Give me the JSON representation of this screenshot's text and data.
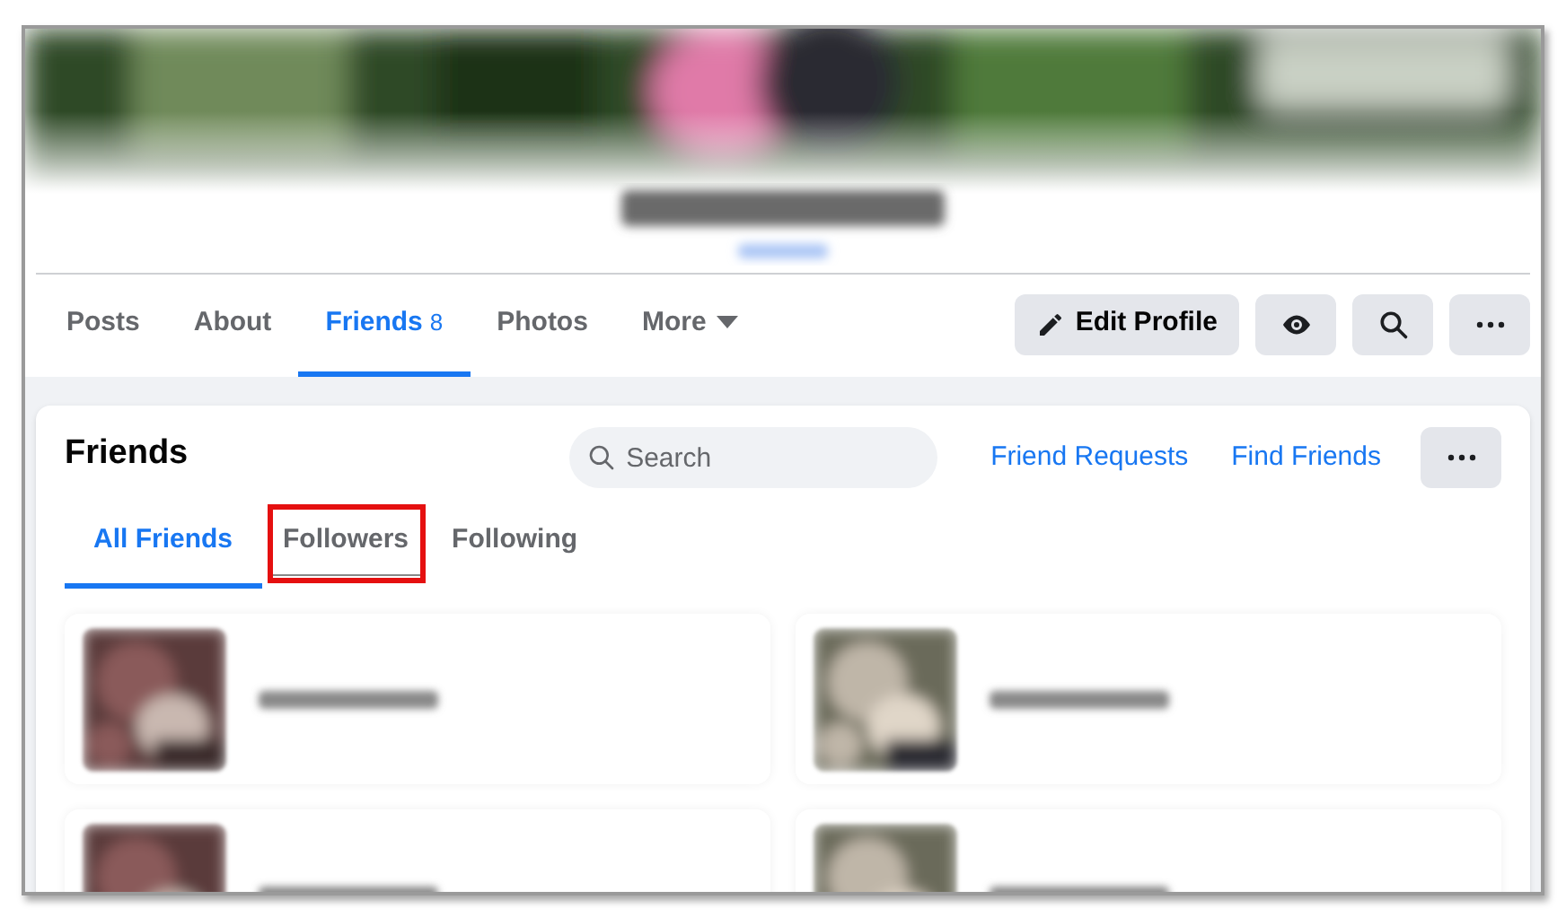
{
  "cover": {
    "kind": "picture"
  },
  "profile_tabs": [
    {
      "label": "Posts",
      "selected": false
    },
    {
      "label": "About",
      "selected": false
    },
    {
      "label": "Friends",
      "count": "8",
      "selected": true
    },
    {
      "label": "Photos",
      "selected": false
    },
    {
      "label": "More",
      "kind": "dropdown",
      "selected": false
    }
  ],
  "profile_actions": [
    {
      "kind": "edit",
      "label": "Edit Profile"
    },
    {
      "kind": "view"
    },
    {
      "kind": "search"
    },
    {
      "kind": "more"
    }
  ],
  "friends_section": {
    "title": "Friends",
    "search": {
      "placeholder": "Search"
    },
    "links": [
      "Friend Requests",
      "Find Friends"
    ],
    "tabs": [
      {
        "label": "All Friends",
        "selected": true,
        "highlighted": false
      },
      {
        "label": "Followers",
        "selected": false,
        "highlighted": true
      },
      {
        "label": "Following",
        "selected": false,
        "highlighted": false
      }
    ],
    "friends": [
      {
        "kind": "picture"
      },
      {
        "kind": "picture"
      },
      {
        "kind": "picture"
      },
      {
        "kind": "picture"
      }
    ]
  }
}
